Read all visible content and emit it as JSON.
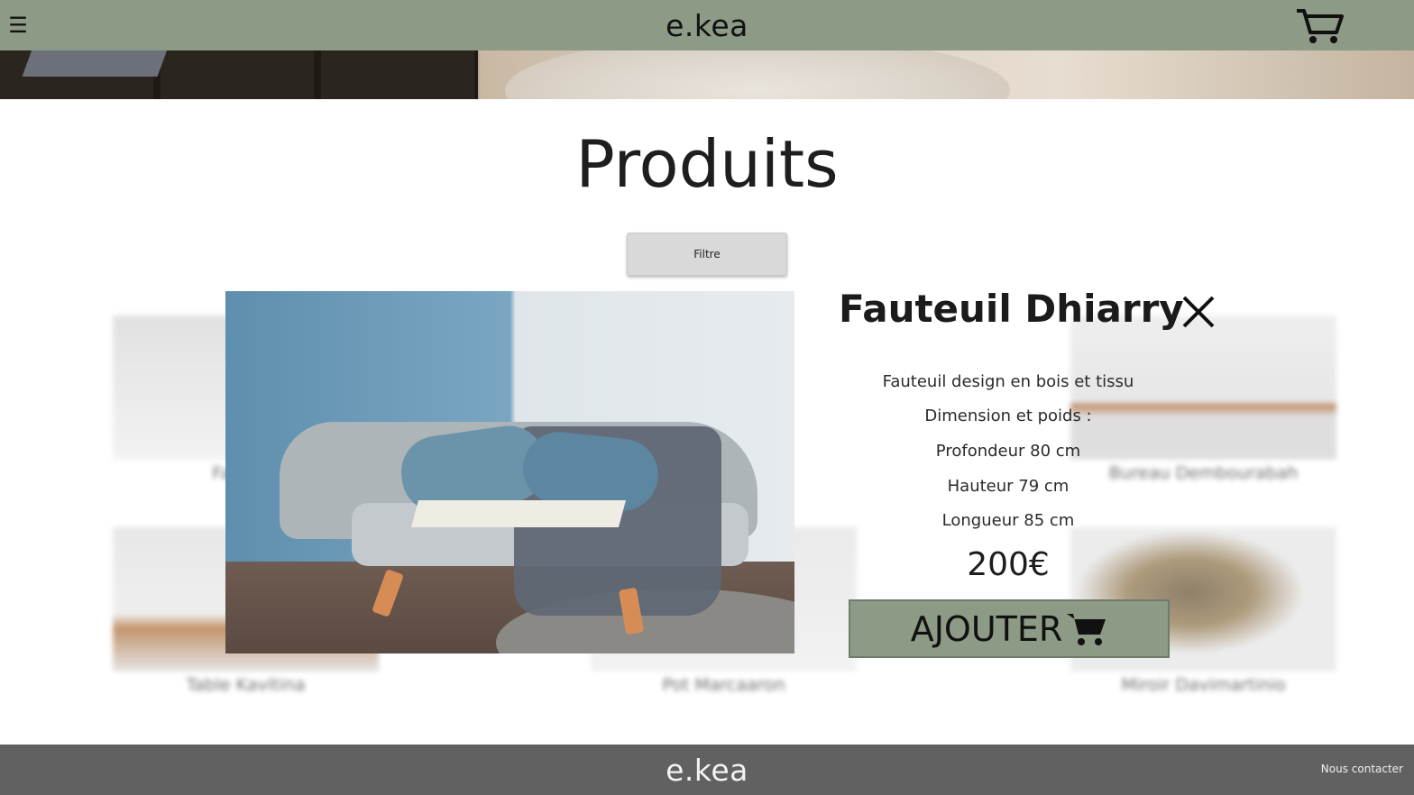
{
  "header": {
    "logo": "e.kea",
    "menu_icon": "hamburger-icon",
    "cart_icon": "cart-icon",
    "bar_color": "#8c9a86"
  },
  "main": {
    "title": "Produits",
    "filter_label": "Filtre",
    "grid_items": [
      {
        "label": "Fauteuil"
      },
      {
        "label": "Bureau Dembourabah"
      },
      {
        "label": "Table Kavitina"
      },
      {
        "label": "Pot Marcaaron"
      },
      {
        "label": "Miroir Davimartinio"
      }
    ]
  },
  "modal": {
    "name": "Fauteuil Dhiarry",
    "close_icon": "close-icon",
    "description_lines": [
      "Fauteuil design en bois et tissu",
      "Dimension et poids :",
      "Profondeur 80 cm",
      "Hauteur 79 cm",
      "Longueur 85 cm"
    ],
    "price": "200€",
    "add_label": "AJOUTER",
    "add_icon": "cart-icon"
  },
  "footer": {
    "logo": "e.kea",
    "contact": "Nous contacter",
    "bar_color": "#616161"
  }
}
